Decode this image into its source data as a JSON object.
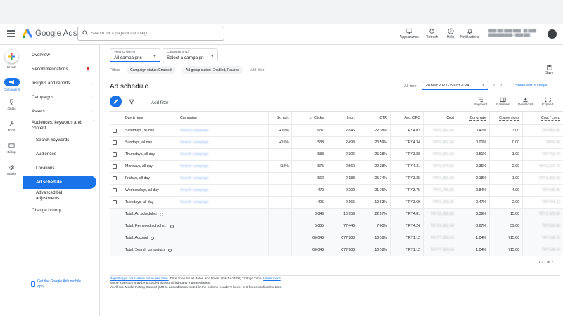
{
  "header": {
    "brand": "Google Ads",
    "search_placeholder": "Search for a page or campaign",
    "tools": [
      {
        "label": "Appearance"
      },
      {
        "label": "Refresh"
      },
      {
        "label": "Help"
      },
      {
        "label": "Notifications"
      }
    ]
  },
  "rail": {
    "create": "Create",
    "campaigns": "Campaigns",
    "goals": "Goals",
    "tools": "Tools",
    "billing": "Billing",
    "admin": "Admin"
  },
  "nav": {
    "overview": "Overview",
    "recommendations": "Recommendations",
    "insights": "Insights and reports",
    "campaigns": "Campaigns",
    "assets": "Assets",
    "audiences_line1": "Audiences, keywords and",
    "audiences_line2": "content",
    "search_keywords": "Search keywords",
    "audiences": "Audiences",
    "locations": "Locations",
    "ad_schedule": "Ad schedule",
    "advanced_line1": "Advanced bid",
    "advanced_line2": "adjustments",
    "change_history": "Change history",
    "mobile_line1": "Get the Google Ads mobile",
    "mobile_line2": "app"
  },
  "selectors": {
    "view_small": "View (2 filters)",
    "view_value": "All campaigns",
    "campaigns_small": "Campaigns (1)",
    "campaigns_value": "Select a campaign"
  },
  "filters": {
    "label": "Filters",
    "chips": [
      "Campaign status: Enabled",
      "Ad group status: Enabled, Paused"
    ],
    "add": "Add filter"
  },
  "save_label": "Save",
  "page_title": "Ad schedule",
  "date": {
    "all_time": "All time",
    "range": "28 Mar 2020 - 5 Oct 2024",
    "show_last": "Show last 30 days"
  },
  "toolbar": {
    "add_filter": "Add filter",
    "segment": "Segment",
    "columns": "Columns",
    "download": "Download",
    "expand": "Expand"
  },
  "table": {
    "columns": [
      "Day & time",
      "Campaign",
      "Bid adj.",
      "Clicks",
      "Impr.",
      "CTR",
      "Avg. CPC",
      "Cost",
      "Conv. rate",
      "Conversions",
      "Cost / conv."
    ],
    "rows": [
      {
        "day": "Saturdays, all day",
        "campaign": "Search campaign",
        "bid": "+10%",
        "clicks": "637",
        "impr": "2,846",
        "ctr": "22.38%",
        "cpc": "TRY4.02",
        "cost": "TRY2,561.54",
        "conv_rate": "0.47%",
        "conversions": "3.00",
        "cost_conv": "TRY853.85"
      },
      {
        "day": "Sundays, all day",
        "campaign": "Search campaign",
        "bid": "+15%",
        "clicks": "588",
        "impr": "2,493",
        "ctr": "23.59%",
        "cpc": "TRY4.34",
        "cost": "TRY2,551.92",
        "conv_rate": "0.00%",
        "conversions": "0.00",
        "cost_conv": "TRY0.00"
      },
      {
        "day": "Thursdays, all day",
        "campaign": "Search campaign",
        "bid": "--",
        "clicks": "583",
        "impr": "2,306",
        "ctr": "25.28%",
        "cpc": "TRY3.88",
        "cost": "TRY2,261.10",
        "conv_rate": "0.51%",
        "conversions": "3.00",
        "cost_conv": "TRY753.70"
      },
      {
        "day": "Mondays, all day",
        "campaign": "Search campaign",
        "bid": "+12%",
        "clicks": "575",
        "impr": "2,569",
        "ctr": "22.38%",
        "cpc": "TRY4.31",
        "cost": "TRY2,475.50",
        "conv_rate": "0.35%",
        "conversions": "2.00",
        "cost_conv": "TRY1,237.75"
      },
      {
        "day": "Fridays, all day",
        "campaign": "Search campaign",
        "bid": "--",
        "clicks": "562",
        "impr": "2,183",
        "ctr": "25.74%",
        "cpc": "TRY3.35",
        "cost": "TRY1,881.30",
        "conv_rate": "0.18%",
        "conversions": "1.00",
        "cost_conv": "TRY1,881.30"
      },
      {
        "day": "Wednesdays, all day",
        "campaign": "Search campaign",
        "bid": "--",
        "clicks": "479",
        "impr": "2,202",
        "ctr": "21.75%",
        "cpc": "TRY3.75",
        "cost": "TRY1,796.25",
        "conv_rate": "0.84%",
        "conversions": "4.00",
        "cost_conv": "TRY449.06"
      },
      {
        "day": "Tuesdays, all day",
        "campaign": "Search campaign",
        "bid": "--",
        "clicks": "425",
        "impr": "2,165",
        "ctr": "19.63%",
        "cpc": "TRY3.69",
        "cost": "TRY1,568.25",
        "conv_rate": "0.47%",
        "conversions": "2.00",
        "cost_conv": "TRY784.13"
      }
    ],
    "totals": [
      {
        "label": "Total: Ad schedules",
        "clicks": "3,849",
        "impr": "16,759",
        "ctr": "22.97%",
        "cpc": "TRY4.01",
        "cost": "TRY15,435.86",
        "conv_rate": "0.39%",
        "conversions": "15.00",
        "cost_conv": "TRY1,029.06"
      },
      {
        "label": "Total: Removed ad sche...",
        "clicks": "5,885",
        "impr": "77,446",
        "ctr": "7.60%",
        "cpc": "TRY4.24",
        "cost": "TRY24,952.40",
        "conv_rate": "0.67%",
        "conversions": "39.00",
        "cost_conv": "TRY639.80"
      },
      {
        "label": "Total: Account",
        "clicks": "69,043",
        "impr": "677,988",
        "ctr": "10.18%",
        "cpc": "TRY1.12",
        "cost": "TRY77,328.16",
        "conv_rate": "1.04%",
        "conversions": "715.00",
        "cost_conv": "TRY108.15"
      },
      {
        "label": "Total: Search campaigns",
        "clicks": "69,043",
        "impr": "677,988",
        "ctr": "10.18%",
        "cpc": "TRY1.12",
        "cost": "TRY77,328.16",
        "conv_rate": "1.04%",
        "conversions": "715.00",
        "cost_conv": "TRY108.15"
      }
    ],
    "pager": "1 - 7 of 7"
  },
  "footer": {
    "link": "Reporting is not carried out in real time.",
    "line1_rest": " Time zone for all dates and times: (GMT+03:00) Türkiye Time.",
    "learn_more": "Learn more",
    "line2": "Some inventory may be provided through third-party intermediaries.",
    "line3": "You'll see Media Rating Council (MRC) accreditation noted in the column header's hover text for accredited metrics."
  },
  "colors": {
    "accent": "#1a73e8",
    "recommendation_dot": "#d93025"
  }
}
